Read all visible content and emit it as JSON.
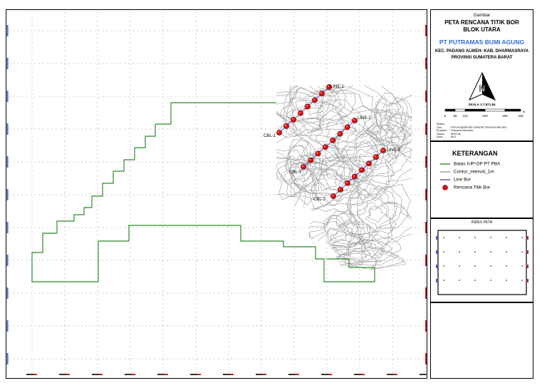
{
  "title": {
    "label": "Gambar",
    "main_line1": "PETA RENCANA TITIK BOR",
    "main_line2": "BLOK UTARA",
    "company": "PT PUTRAMAS BUMI AGUNG",
    "location_line1": "KEC. PADANG ALWEH- KAB. DHARMASRAYA",
    "location_line2": "PROVINSI SUMATERA BARAT",
    "scale": "SKALA 1:7.871,94",
    "scale_ticks": [
      "0",
      "55",
      "110",
      "220",
      "330",
      "440"
    ],
    "scale_unit": "M",
    "notes": [
      {
        "key": "Sistem Grid",
        "value": ": Grid Geografis dan Universal Tranverse Mercator"
      },
      {
        "key": "Proyeksi",
        "value": ": Tranverse Mercator"
      },
      {
        "key": "Datum",
        "value": ": WGS 84"
      },
      {
        "key": "Zona",
        "value": ": 48 S"
      }
    ]
  },
  "legend": {
    "heading": "KETERANGAN",
    "items": [
      {
        "label": "Batas IUP-OP PT PBA",
        "color": "#2e8b2e",
        "symbol": "line"
      },
      {
        "label": "Contur_interval_1m",
        "color": "#9a9a9a",
        "symbol": "line"
      },
      {
        "label": "Line Bor",
        "color": "#7b3fbf",
        "symbol": "line"
      },
      {
        "label": "Rencana Titik Bor",
        "color": "#e01010",
        "symbol": "point"
      }
    ]
  },
  "index_map": {
    "heading": "INDEX PETA"
  },
  "map": {
    "line_labels": [
      "LINE-1",
      "LINE-2",
      "LINE-3"
    ],
    "point_labels": [
      "CBL-1",
      "CBL-2",
      "CBL-3"
    ],
    "colors": {
      "boundary": "#2e8b2e",
      "contour": "#9a9a9a",
      "grid": "#999999",
      "coord_top": "#3a5fcd",
      "coord_red": "#cc2020",
      "drill": "#e01010"
    }
  }
}
